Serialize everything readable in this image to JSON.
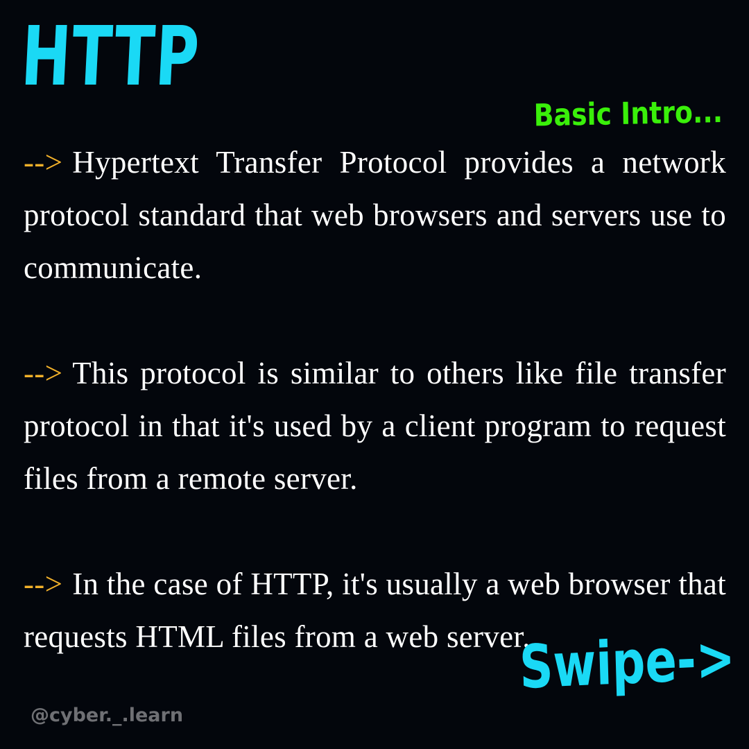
{
  "header": {
    "title": "HTTP",
    "subtitle": "Basic Intro..."
  },
  "paragraphs": [
    {
      "arrow": "-->",
      "text": "Hypertext Transfer Protocol provides a network protocol standard that web browsers and servers use to communicate."
    },
    {
      "arrow": "-->",
      "text": "This protocol is similar to others like file transfer protocol in that it's used by a client program to request files from a remote server."
    },
    {
      "arrow": "-->",
      "text": "In the case of HTTP, it's usually a web browser that requests HTML files from a web server."
    }
  ],
  "footer": {
    "swipe_label": "Swipe->",
    "handle": "@cyber._.learn"
  },
  "colors": {
    "background": "#03060c",
    "title": "#1ad9f5",
    "subtitle": "#3af00a",
    "arrow": "#f2b12a",
    "body_text": "#ffffff",
    "handle": "#6f7074"
  }
}
